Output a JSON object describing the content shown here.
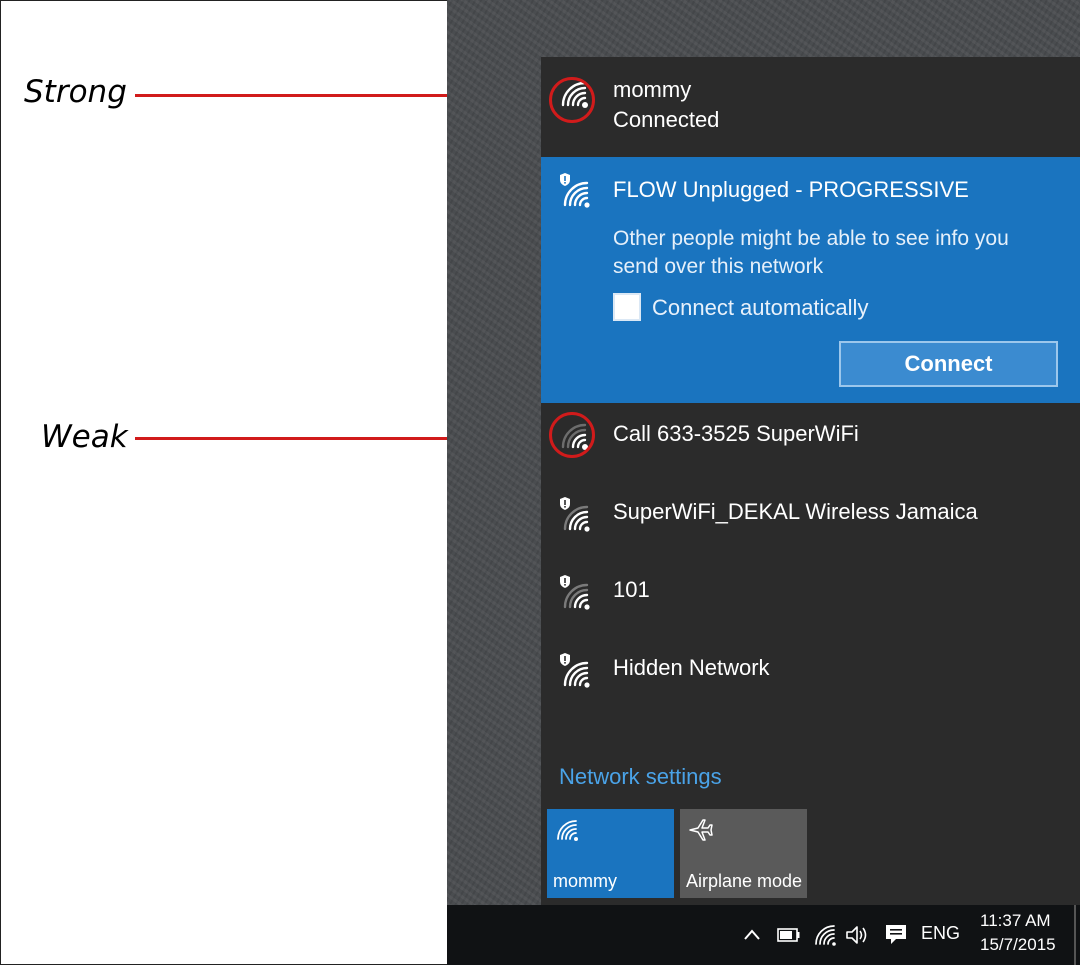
{
  "annotations": {
    "strong_label": "Strong",
    "weak_label": "Weak",
    "accent_color": "#d11b1b"
  },
  "flyout": {
    "networks": [
      {
        "name": "mommy",
        "status": "Connected",
        "secured": true,
        "signal": "strong",
        "icon": "wifi-strong-icon"
      },
      {
        "name": "FLOW Unplugged - PROGRESSIVE",
        "secured": false,
        "selected": true,
        "warning": "Other people might be able to see info you send over this network",
        "connect_auto_label": "Connect automatically",
        "connect_auto_checked": false,
        "connect_button": "Connect",
        "icon": "wifi-open-shield-icon"
      },
      {
        "name": "Call 633-3525 SuperWiFi",
        "secured": true,
        "signal": "weak",
        "icon": "wifi-weak-icon"
      },
      {
        "name": "SuperWiFi_DEKAL Wireless Jamaica",
        "secured": false,
        "icon": "wifi-open-shield-icon"
      },
      {
        "name": "101",
        "secured": false,
        "icon": "wifi-open-shield-icon"
      },
      {
        "name": "Hidden Network",
        "secured": false,
        "icon": "wifi-open-shield-icon"
      }
    ],
    "network_settings_link": "Network settings",
    "tiles": [
      {
        "label": "mommy",
        "icon": "wifi-icon",
        "active": true,
        "color": "#1a74bf"
      },
      {
        "label": "Airplane mode",
        "icon": "airplane-icon",
        "active": false,
        "color": "#5a5a5a"
      }
    ],
    "selected_color": "#1a74bf",
    "background_color": "#2b2b2b"
  },
  "taskbar": {
    "language": "ENG",
    "time": "11:37 AM",
    "date": "15/7/2015",
    "tray_icons": [
      "chevron-up-icon",
      "battery-icon",
      "wifi-icon",
      "volume-icon",
      "action-center-icon"
    ]
  }
}
